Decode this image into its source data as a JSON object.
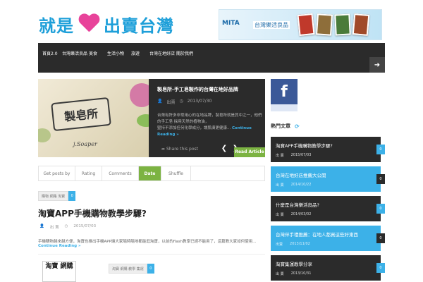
{
  "header": {
    "logo_left": "就是",
    "logo_right": "出賣台灣",
    "banner_brand": "MITA",
    "banner_text": "台灣樂活良品"
  },
  "nav": {
    "items": [
      "首頁2.0",
      "台灣樂活良品",
      "美食",
      "生活小物",
      "旅遊",
      "台灣在地好店",
      "關於我們"
    ]
  },
  "slider": {
    "image_label": "製皂所",
    "image_sub": "j.Soaper",
    "title": "製皂所-手工皂製作的台灣在地好品牌",
    "author": "出賣",
    "date": "2013/07/30",
    "excerpt": "台灣有許多非常用心的在地品牌，製皂所就是其中之一，他們的手工皂 採用天然的植物油，",
    "excerpt2": "堅持不添加任何化學成分，讓肌膚更健康...",
    "more": "Continue Reading »",
    "share": "Share this post",
    "read": "Read Article"
  },
  "tabs": [
    "Get posts by",
    "Rating",
    "Comments",
    "Date",
    "Shuffle"
  ],
  "posts": [
    {
      "tag": "購物 網路 淘寶",
      "count": "0",
      "title": "淘寶APP手機購物教學步驟?",
      "author": "出 賣",
      "date": "2015/07/03",
      "excerpt": "手機購物越來越方便，淘寶也推出手機APP讓大家隨時隨地都能逛淘寶，以前的flash教學已經不能用了，這篇教大家如何使用...",
      "more": "Continue Reading »"
    },
    {
      "tag": "淘寶 網購 教學 集運",
      "count": "0",
      "book": "淘寶 網購"
    }
  ],
  "sidebar": {
    "heading": "熱門文章",
    "items": [
      {
        "title": "淘寶APP手機購物教學步驟?",
        "author": "出 賣",
        "date": "2015/07/03",
        "count": "0"
      },
      {
        "title": "台灣在地好店推薦大公開",
        "author": "出 賣",
        "date": "2014/10/22",
        "count": "0"
      },
      {
        "title": "什麼是台灣樂活良品?",
        "author": "出 賣",
        "date": "2014/03/02",
        "count": "0"
      },
      {
        "title": "台灣伴手禮推薦：在地人都買這些好東西",
        "author": "出賣",
        "date": "2013/11/02",
        "count": "0"
      },
      {
        "title": "淘寶集運教學分享",
        "author": "出 賣",
        "date": "2013/10/31",
        "count": "0"
      }
    ]
  },
  "colors": {
    "accent_blue": "#3cb1e8",
    "accent_green": "#7cb342",
    "dark": "#2b2b2b",
    "logo_pink": "#e8439a"
  }
}
